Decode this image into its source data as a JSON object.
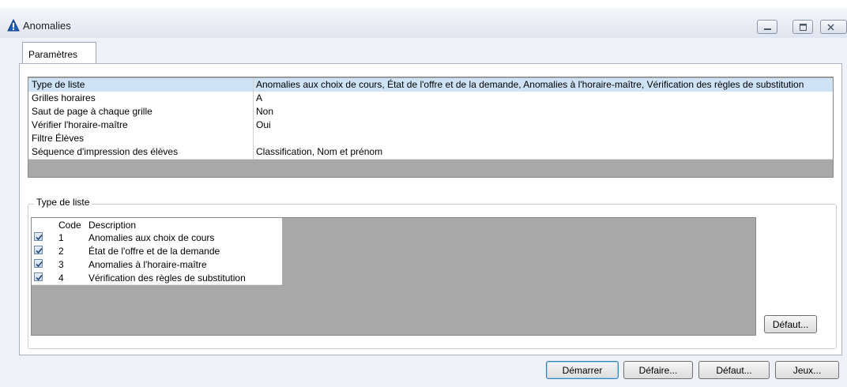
{
  "window": {
    "title": "Anomalies"
  },
  "tabs": [
    {
      "label": "Paramètres"
    }
  ],
  "params": [
    {
      "label": "Type de liste",
      "value": "Anomalies aux choix de cours, État de l'offre et de la demande, Anomalies à l'horaire-maître, Vérification des règles de substitution",
      "selected": true
    },
    {
      "label": "Grilles horaires",
      "value": "A"
    },
    {
      "label": "Saut de page à chaque grille",
      "value": "Non"
    },
    {
      "label": "Vérifier l'horaire-maître",
      "value": "Oui"
    },
    {
      "label": "Filtre Élèves",
      "value": ""
    },
    {
      "label": "Séquence d'impression des élèves",
      "value": "Classification, Nom et prénom"
    }
  ],
  "list_group": {
    "label": "Type de liste",
    "columns": {
      "code": "Code",
      "description": "Description"
    },
    "rows": [
      {
        "code": "1",
        "description": "Anomalies aux choix de cours",
        "checked": true
      },
      {
        "code": "2",
        "description": "État de l'offre et de la demande",
        "checked": true
      },
      {
        "code": "3",
        "description": "Anomalies à l'horaire-maître",
        "checked": true
      },
      {
        "code": "4",
        "description": "Vérification des règles de substitution",
        "checked": true
      }
    ],
    "default_button": "Défaut..."
  },
  "footer": {
    "start": "Démarrer",
    "undo": "Défaire...",
    "default": "Défaut...",
    "sets": "Jeux..."
  },
  "colors": {
    "selection": "#cfe3f6",
    "grid_bg": "#a8a8a8",
    "accent": "#1f5fbf"
  },
  "icons": [
    "app-warning-icon",
    "minimize-icon",
    "maximize-icon",
    "close-icon",
    "checkmark-icon"
  ]
}
